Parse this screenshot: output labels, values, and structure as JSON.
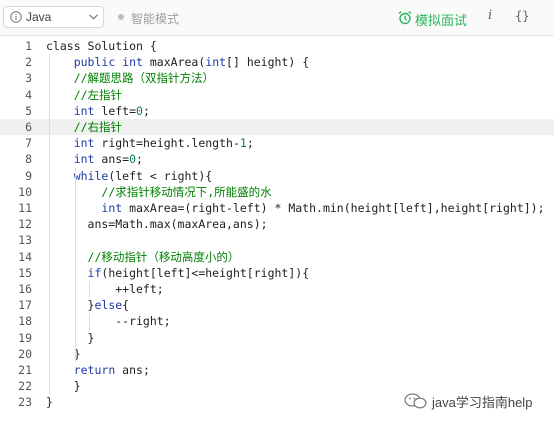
{
  "toolbar": {
    "language": "Java",
    "smart_mode_label": "智能模式",
    "mock_interview_label": "模拟面试",
    "info_label": "i",
    "braces_label": "{}",
    "accent_color": "#2db55d"
  },
  "editor": {
    "active_line": 6,
    "lines": [
      [
        {
          "t": "class Solution {"
        }
      ],
      [
        {
          "t": "    "
        },
        {
          "t": "public int",
          "c": "kw"
        },
        {
          "t": " maxArea("
        },
        {
          "t": "int",
          "c": "kw"
        },
        {
          "t": "[] height) {"
        }
      ],
      [
        {
          "t": "    "
        },
        {
          "t": "//解题思路（双指针方法）",
          "c": "cm"
        }
      ],
      [
        {
          "t": "    "
        },
        {
          "t": "//左指针",
          "c": "cm"
        }
      ],
      [
        {
          "t": "    "
        },
        {
          "t": "int",
          "c": "kw"
        },
        {
          "t": " left="
        },
        {
          "t": "0",
          "c": "nm"
        },
        {
          "t": ";"
        }
      ],
      [
        {
          "t": "    "
        },
        {
          "t": "//右指针",
          "c": "cm"
        }
      ],
      [
        {
          "t": "    "
        },
        {
          "t": "int",
          "c": "kw"
        },
        {
          "t": " right=height.length-"
        },
        {
          "t": "1",
          "c": "nm"
        },
        {
          "t": ";"
        }
      ],
      [
        {
          "t": "    "
        },
        {
          "t": "int",
          "c": "kw"
        },
        {
          "t": " ans="
        },
        {
          "t": "0",
          "c": "nm"
        },
        {
          "t": ";"
        }
      ],
      [
        {
          "t": "    "
        },
        {
          "t": "while",
          "c": "kw"
        },
        {
          "t": "(left < right){"
        }
      ],
      [
        {
          "t": "        "
        },
        {
          "t": "//求指针移动情况下,所能盛的水",
          "c": "cm"
        }
      ],
      [
        {
          "t": "        "
        },
        {
          "t": "int",
          "c": "kw"
        },
        {
          "t": " maxArea=(right-left) * Math.min(height[left],height[right]);"
        }
      ],
      [
        {
          "t": "      ans=Math.max(maxArea,ans);"
        }
      ],
      [
        {
          "t": ""
        }
      ],
      [
        {
          "t": "      "
        },
        {
          "t": "//移动指针（移动高度小的）",
          "c": "cm"
        }
      ],
      [
        {
          "t": "      "
        },
        {
          "t": "if",
          "c": "kw"
        },
        {
          "t": "(height[left]<=height[right]){"
        }
      ],
      [
        {
          "t": "          ++left;"
        }
      ],
      [
        {
          "t": "      }"
        },
        {
          "t": "else",
          "c": "kw"
        },
        {
          "t": "{"
        }
      ],
      [
        {
          "t": "          --right;"
        }
      ],
      [
        {
          "t": "      }"
        }
      ],
      [
        {
          "t": "    }"
        }
      ],
      [
        {
          "t": "    "
        },
        {
          "t": "return",
          "c": "kw"
        },
        {
          "t": " ans;"
        }
      ],
      [
        {
          "t": "    }"
        }
      ],
      [
        {
          "t": "}"
        }
      ]
    ]
  },
  "watermark": {
    "text": "java学习指南help"
  }
}
